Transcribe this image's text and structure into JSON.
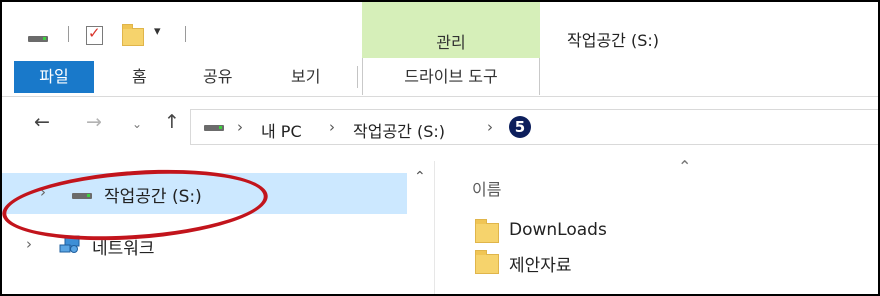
{
  "window": {
    "title": "작업공간 (S:)"
  },
  "contextual_group": {
    "label": "관리",
    "color": "#d6efb9"
  },
  "ribbon": {
    "file_tab": "파일",
    "tabs": [
      "홈",
      "공유",
      "보기"
    ],
    "contextual_tab": "드라이브 도구",
    "accent": "#1979ca"
  },
  "address": {
    "crumbs": [
      "내 PC",
      "작업공간 (S:)"
    ],
    "marker": "5"
  },
  "nav_pane": {
    "items": [
      {
        "label": "작업공간 (S:)",
        "selected": true
      },
      {
        "label": "네트워크",
        "selected": false
      }
    ],
    "highlight_color": "#c2141c"
  },
  "content": {
    "column_header": "이름",
    "files": [
      {
        "name": "DownLoads",
        "icon": "folder-icon"
      },
      {
        "name": "제안자료",
        "icon": "folder-icon"
      }
    ]
  }
}
